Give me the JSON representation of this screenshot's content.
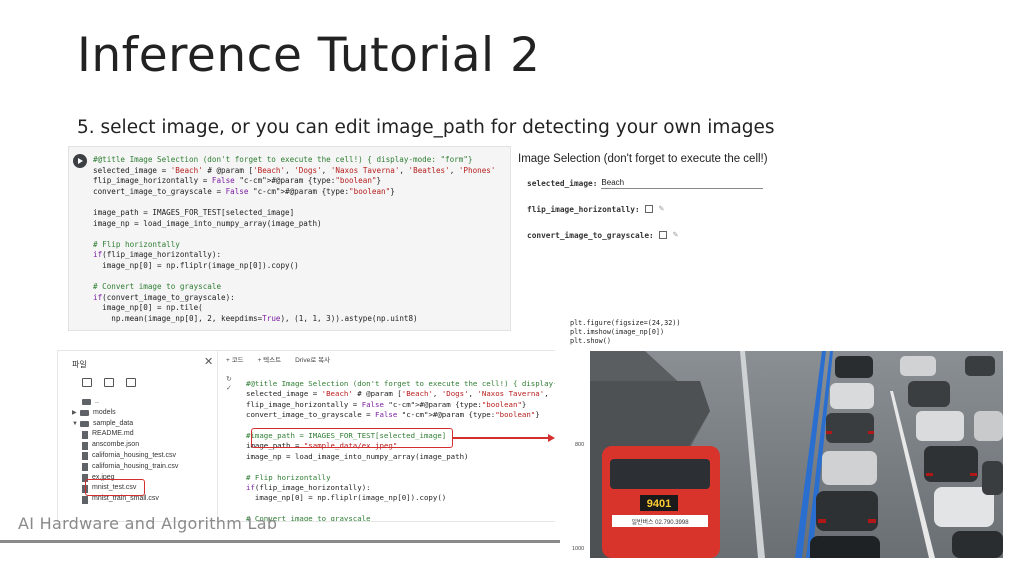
{
  "slide": {
    "title": "Inference Tutorial 2",
    "subtitle": "5. select image, or you can edit image_path for detecting your own images",
    "footer_logo": "AI Hardware and Algorithm Lab"
  },
  "top_cell": {
    "code_lines": [
      "#@title Image Selection (don't forget to execute the cell!) { display-mode: \"form\"}",
      "selected_image = 'Beach' # @param ['Beach', 'Dogs', 'Naxos Taverna', 'Beatles', 'Phones'",
      "flip_image_horizontally = False #@param {type:\"boolean\"}",
      "convert_image_to_grayscale = False #@param {type:\"boolean\"}",
      "",
      "image_path = IMAGES_FOR_TEST[selected_image]",
      "image_np = load_image_into_numpy_array(image_path)",
      "",
      "# Flip horizontally",
      "if(flip_image_horizontally):",
      "  image_np[0] = np.fliplr(image_np[0]).copy()",
      "",
      "# Convert image to grayscale",
      "if(convert_image_to_grayscale):",
      "  image_np[0] = np.tile(",
      "    np.mean(image_np[0], 2, keepdims=True), (1, 1, 3)).astype(np.uint8)"
    ]
  },
  "form": {
    "title": "Image Selection (don't forget to execute the cell!)",
    "selected_image_label": "selected_image:",
    "selected_image_value": "Beach",
    "flip_label": "flip_image_horizontally:",
    "flip_checked": false,
    "grayscale_label": "convert_image_to_grayscale:",
    "grayscale_checked": false
  },
  "files_panel": {
    "title": "파일",
    "close": "✕",
    "tree": [
      {
        "kind": "parent",
        "label": ".."
      },
      {
        "kind": "folder",
        "label": "models",
        "expanded": false
      },
      {
        "kind": "folder",
        "label": "sample_data",
        "expanded": true
      },
      {
        "kind": "file",
        "label": "README.md"
      },
      {
        "kind": "file",
        "label": "anscombe.json"
      },
      {
        "kind": "file",
        "label": "california_housing_test.csv"
      },
      {
        "kind": "file",
        "label": "california_housing_train.csv"
      },
      {
        "kind": "file",
        "label": "ex.jpeg"
      },
      {
        "kind": "file",
        "label": "mnist_test.csv"
      },
      {
        "kind": "file",
        "label": "mnist_train_small.csv"
      }
    ]
  },
  "notebook": {
    "toolbar": [
      "+ 코드",
      "+ 텍스트",
      "Drive로 복사"
    ],
    "code_lines": [
      "#@title Image Selection (don't forget to execute the cell!) { display-mo",
      "selected_image = 'Beach' # @param ['Beach', 'Dogs', 'Naxos Taverna', 'Be",
      "flip_image_horizontally = False #@param {type:\"boolean\"}",
      "convert_image_to_grayscale = False #@param {type:\"boolean\"}",
      "",
      "#image_path = IMAGES_FOR_TEST[selected_image]",
      "image_path = \"sample_data/ex.jpeg\"",
      "image_np = load_image_into_numpy_array(image_path)",
      "",
      "# Flip horizontally",
      "if(flip_image_horizontally):",
      "  image_np[0] = np.fliplr(image_np[0]).copy()",
      "",
      "# Convert image to grayscale",
      "if(convert image to grayscale):"
    ]
  },
  "image_output": {
    "code_lines": [
      "plt.figure(figsize=(24,32))",
      "plt.imshow(image_np[0])",
      "plt.show()"
    ],
    "y_ticks": [
      "800",
      "1000"
    ],
    "bus_number": "9401",
    "bus_phone": "일반버스 02.790.3998"
  },
  "colors": {
    "highlight_red": "#d32f2f",
    "comment_green": "#2e7d32",
    "string_red": "#b71c1c"
  }
}
